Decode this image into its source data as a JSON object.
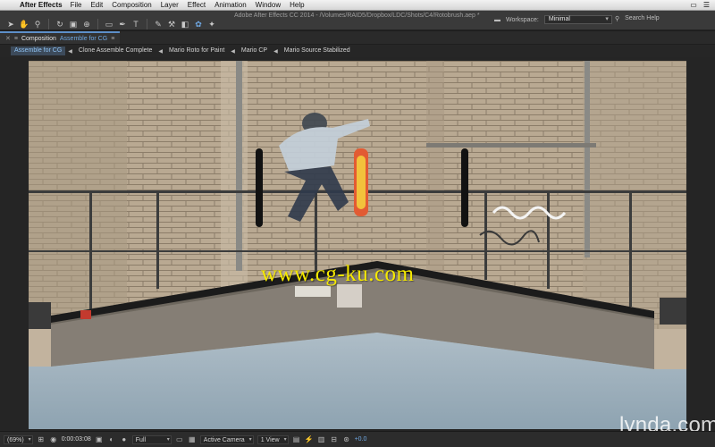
{
  "menubar": {
    "app_name": "After Effects",
    "items": [
      "File",
      "Edit",
      "Composition",
      "Layer",
      "Effect",
      "Animation",
      "Window",
      "Help"
    ]
  },
  "window_title": "Adobe After Effects CC 2014 - /Volumes/RAID5/Dropbox/LDC/Shots/C4/Rotobrush.aep *",
  "workspace": {
    "label": "Workspace:",
    "value": "Minimal"
  },
  "search_help": {
    "label": "Search Help"
  },
  "panel": {
    "tab_prefix": "Composition",
    "comp_name": "Assemble for CG"
  },
  "breadcrumbs": [
    "Assemble for CG",
    "Clone Assemble Complete",
    "Mario Roto for Paint",
    "Mario CP",
    "Mario Source Stabilized"
  ],
  "watermark": "www.cg-ku.com",
  "lynda": "lynda",
  "lynda_suffix": "com",
  "viewer_bar": {
    "zoom": "(69%)",
    "timecode": "0:00:03:08",
    "resolution": "Full",
    "camera": "Active Camera",
    "views": "1 View",
    "exposure": "+0.0"
  },
  "colors": {
    "accent": "#5d8fc8",
    "comp_name": "#6fa8e3",
    "watermark": "#f5e900",
    "toolbar_bg": "#3a3a3a"
  }
}
